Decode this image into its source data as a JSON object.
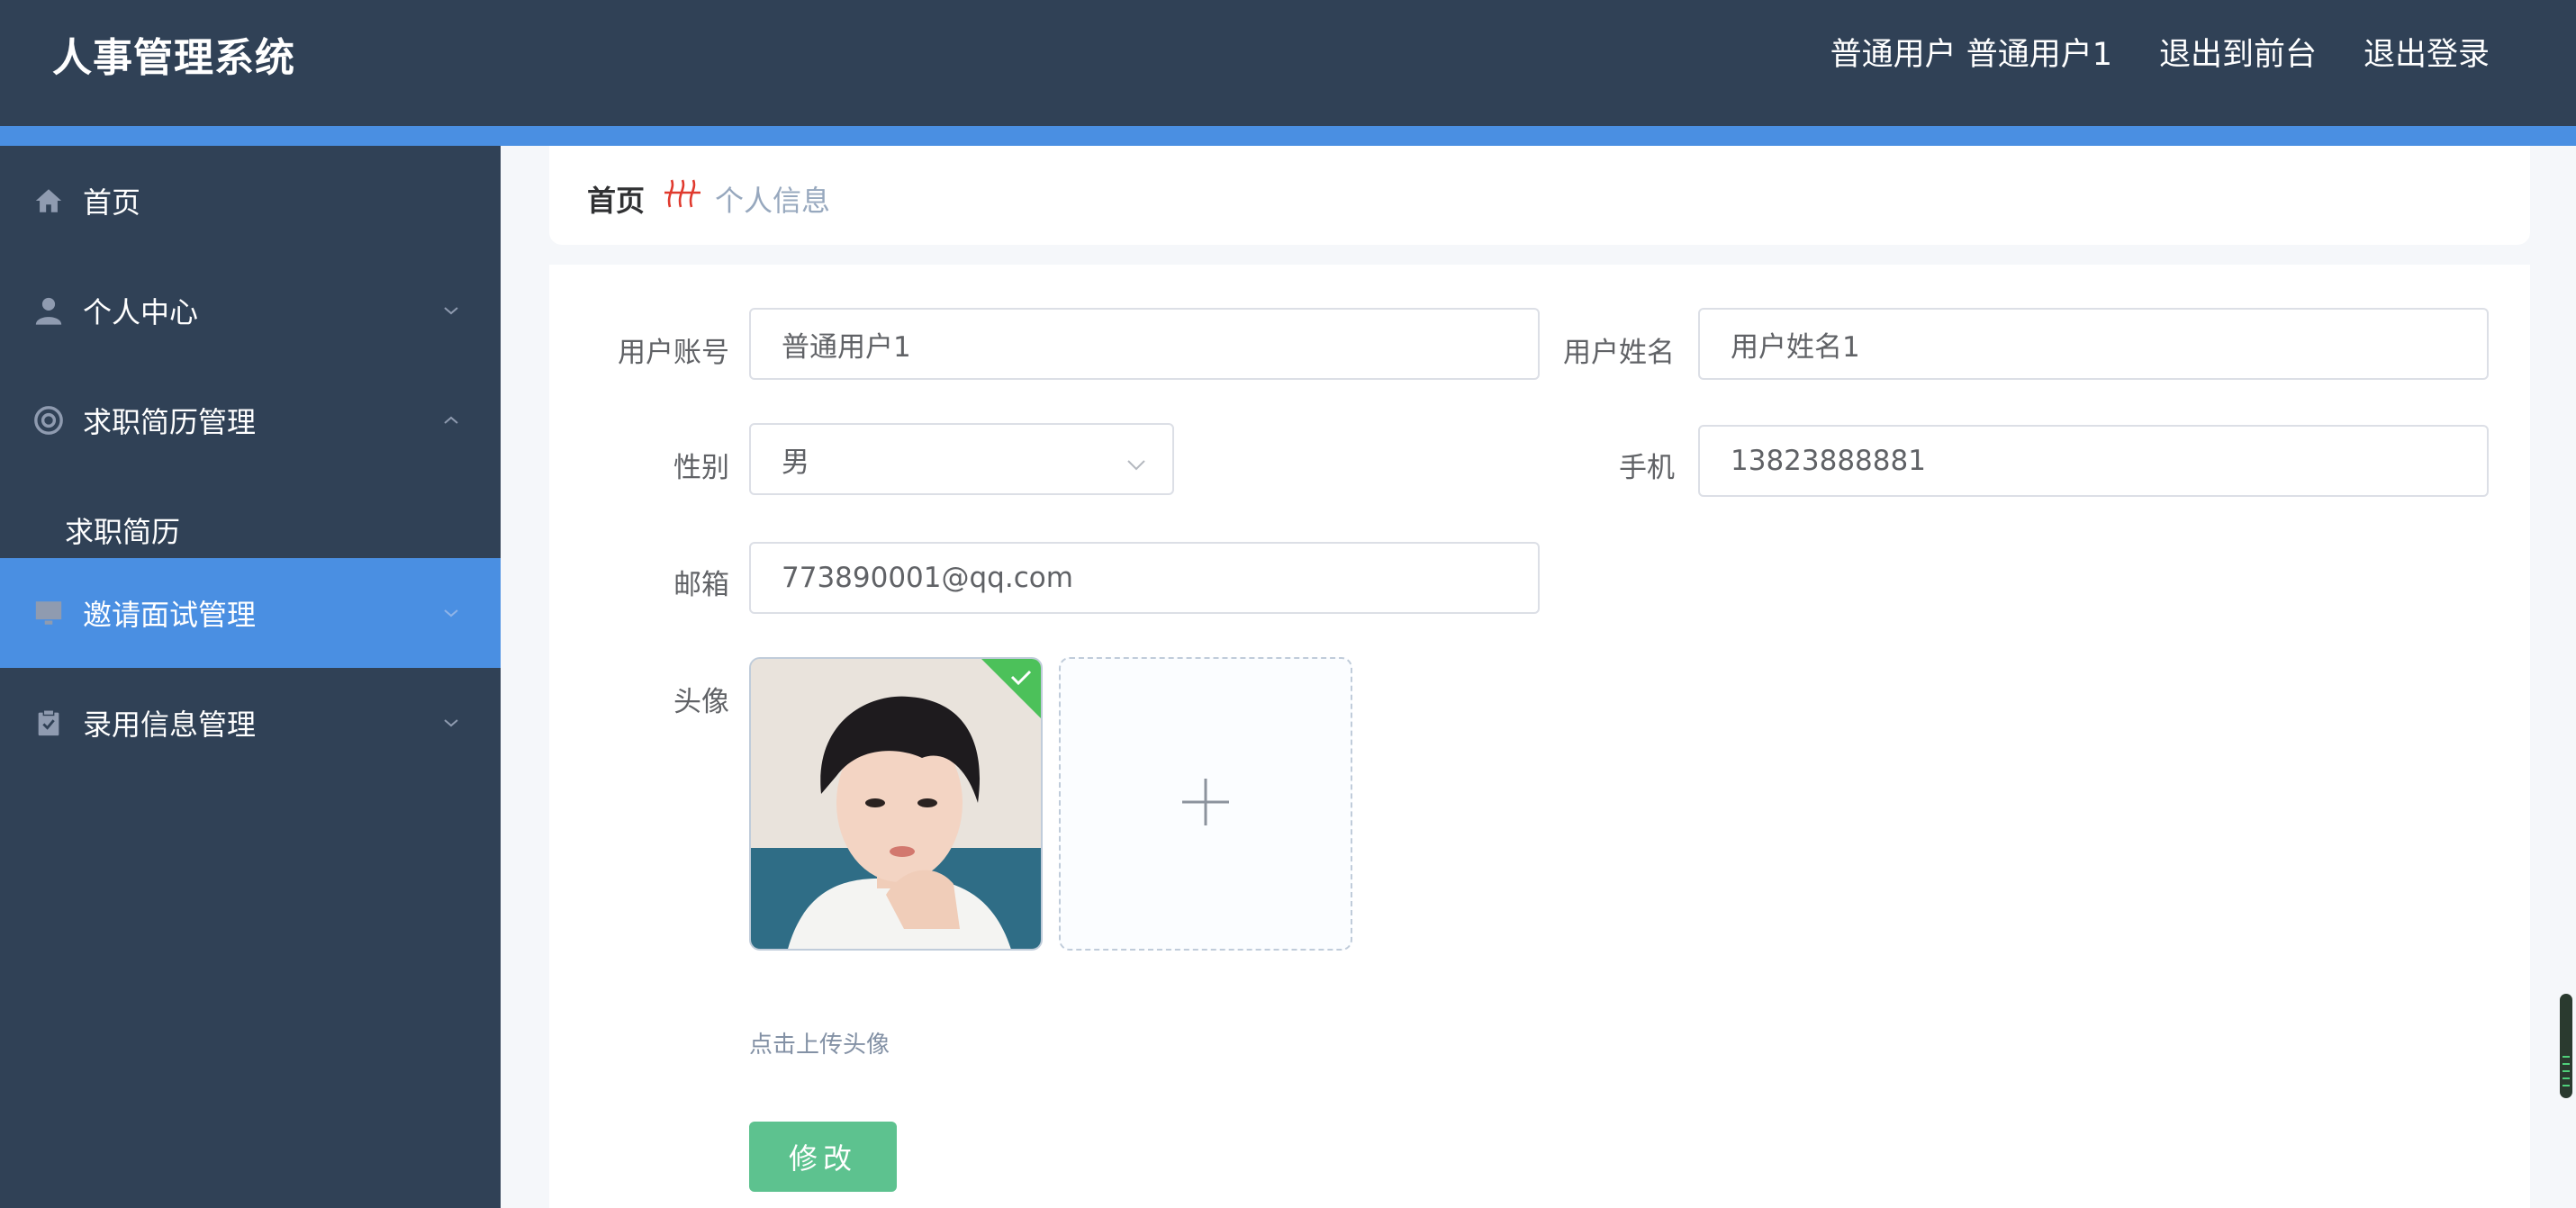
{
  "header": {
    "title": "人事管理系统",
    "user_label": "普通用户 普通用户1",
    "back_to_front": "退出到前台",
    "logout": "退出登录"
  },
  "sidebar": {
    "items": [
      {
        "label": "首页",
        "icon": "home-icon"
      },
      {
        "label": "个人中心",
        "icon": "user-icon"
      },
      {
        "label": "求职简历管理",
        "icon": "lifebuoy-icon"
      },
      {
        "label": "求职简历"
      },
      {
        "label": "邀请面试管理",
        "icon": "monitor-icon"
      },
      {
        "label": "录用信息管理",
        "icon": "clipboard-icon"
      }
    ]
  },
  "breadcrumb": {
    "home": "首页",
    "current": "个人信息"
  },
  "form": {
    "account_label": "用户账号",
    "account_value": "普通用户1",
    "name_label": "用户姓名",
    "name_value": "用户姓名1",
    "gender_label": "性别",
    "gender_value": "男",
    "phone_label": "手机",
    "phone_value": "13823888881",
    "email_label": "邮箱",
    "email_value": "773890001@qq.com",
    "avatar_label": "头像",
    "upload_hint": "点击上传头像",
    "submit_label": "修改"
  },
  "colors": {
    "header_bg": "#304156",
    "accent": "#4a8fe2",
    "button": "#5dc28f",
    "success_badge": "#4cc15a"
  }
}
